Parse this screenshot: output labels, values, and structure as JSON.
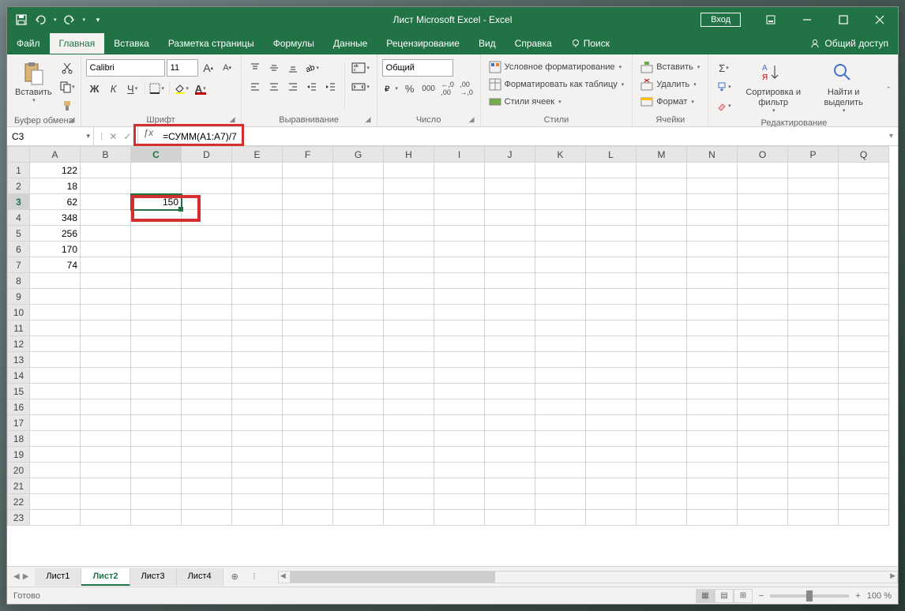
{
  "title": "Лист Microsoft Excel - Excel",
  "login": "Вход",
  "menu": {
    "file": "Файл",
    "home": "Главная",
    "insert": "Вставка",
    "page_layout": "Разметка страницы",
    "formulas": "Формулы",
    "data": "Данные",
    "review": "Рецензирование",
    "view": "Вид",
    "help": "Справка",
    "search": "Поиск",
    "share": "Общий доступ"
  },
  "ribbon": {
    "clipboard": {
      "paste": "Вставить",
      "label": "Буфер обмена"
    },
    "font": {
      "name": "Calibri",
      "size": "11",
      "label": "Шрифт"
    },
    "alignment": {
      "label": "Выравнивание"
    },
    "number": {
      "format": "Общий",
      "label": "Число"
    },
    "styles": {
      "cond_format": "Условное форматирование",
      "format_table": "Форматировать как таблицу",
      "cell_styles": "Стили ячеек",
      "label": "Стили"
    },
    "cells": {
      "insert": "Вставить",
      "delete": "Удалить",
      "format": "Формат",
      "label": "Ячейки"
    },
    "editing": {
      "sort": "Сортировка и фильтр",
      "find": "Найти и выделить",
      "label": "Редактирование"
    }
  },
  "name_box": "C3",
  "formula": "=СУММ(A1:A7)/7",
  "columns": [
    "A",
    "B",
    "C",
    "D",
    "E",
    "F",
    "G",
    "H",
    "I",
    "J",
    "K",
    "L",
    "M",
    "N",
    "O",
    "P",
    "Q"
  ],
  "rows": [
    "1",
    "2",
    "3",
    "4",
    "5",
    "6",
    "7",
    "8",
    "9",
    "10",
    "11",
    "12",
    "13",
    "14",
    "15",
    "16",
    "17",
    "18",
    "19",
    "20",
    "21",
    "22",
    "23"
  ],
  "data_A": [
    "122",
    "18",
    "62",
    "348",
    "256",
    "170",
    "74"
  ],
  "data_C3": "150",
  "sheets": [
    "Лист1",
    "Лист2",
    "Лист3",
    "Лист4"
  ],
  "active_sheet": 1,
  "status": "Готово",
  "zoom": "100 %"
}
